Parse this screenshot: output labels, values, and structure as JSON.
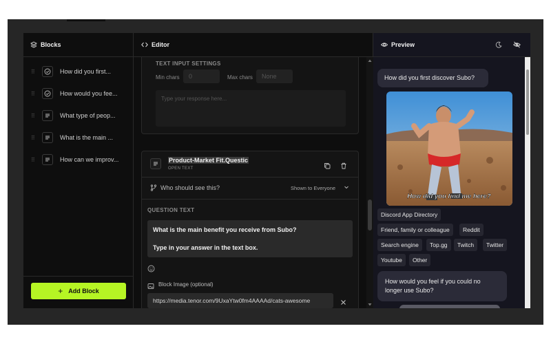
{
  "colors": {
    "accent": "#b6f524",
    "background": "#0e0e0e",
    "preview_bg": "#15151f"
  },
  "panels": {
    "blocks_title": "Blocks",
    "editor_title": "Editor",
    "preview_title": "Preview"
  },
  "sidebar": {
    "items": [
      {
        "label": "How did you first...",
        "icon": "check-circle-icon"
      },
      {
        "label": "How would you fee...",
        "icon": "check-circle-icon"
      },
      {
        "label": "What type of peop...",
        "icon": "text-lines-icon"
      },
      {
        "label": "What is the main ...",
        "icon": "text-lines-icon"
      },
      {
        "label": "How can we improv...",
        "icon": "text-lines-icon"
      }
    ],
    "add_block_label": "Add Block"
  },
  "editor": {
    "settings_title": "TEXT INPUT SETTINGS",
    "min_chars_label": "Min chars",
    "min_chars_placeholder": "0",
    "max_chars_label": "Max chars",
    "max_chars_placeholder": "None",
    "response_placeholder": "Type your response here...",
    "block_title": "Product-Market Fit.Questic",
    "block_type": "OPEN TEXT",
    "visibility_label": "Who should see this?",
    "visibility_value": "Shown to Everyone",
    "question_label": "QUESTION TEXT",
    "question_line1": "What is the main benefit you receive from Subo?",
    "question_line2": "Type in your answer in the text box.",
    "image_label": "Block Image (optional)",
    "image_url": "https://media.tenor.com/9UxaYtw0fm4AAAAd/cats-awesome"
  },
  "preview": {
    "question1": "How did you first discover Subo?",
    "gif_caption": "How did you find me here?",
    "options": [
      "Discord App Directory",
      "Friend, family or colleague",
      "Reddit",
      "Search engine",
      "Top.gg",
      "Twitch",
      "Twitter",
      "Youtube",
      "Other"
    ],
    "question2_line1": "How would you feel if you could no",
    "question2_line2": "longer use Subo?"
  }
}
